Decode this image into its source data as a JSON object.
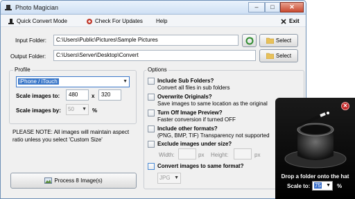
{
  "window": {
    "title": "Photo Magician",
    "controls": {
      "minimize": "–",
      "maximize": "□",
      "close": "✕"
    }
  },
  "menu": {
    "quick_convert": "Quick Convert Mode",
    "check_updates": "Check For Updates",
    "help": "Help",
    "exit": "Exit"
  },
  "folders": {
    "input_label": "Input Folder:",
    "input_value": "C:\\Users\\Public\\Pictures\\Sample Pictures",
    "output_label": "Output Folder:",
    "output_value": "C:\\Users\\Server\\Desktop\\Convert",
    "select_label": "Select"
  },
  "profile": {
    "group_title": "Profile",
    "selected": "iPhone / iTouch",
    "scale_to_label": "Scale images to:",
    "width": "480",
    "x_label": "x",
    "height": "320",
    "scale_by_label": "Scale images by:",
    "scale_by_value": "50",
    "percent": "%",
    "note": "PLEASE NOTE: All images will maintain aspect ratio unless you select 'Custom Size'",
    "process_button": "Process 8 Image(s)"
  },
  "options": {
    "group_title": "Options",
    "items": [
      {
        "title": "Include Sub Folders?",
        "sub": "Convert all files in sub folders"
      },
      {
        "title": "Overwrite Originals?",
        "sub": "Save images to same location as the original"
      },
      {
        "title": "Turn Off Image Preview?",
        "sub": "Faster conversion if turned OFF"
      },
      {
        "title": "Include other formats?",
        "sub": "(PNG, BMP, TIF) Transparency not supported"
      },
      {
        "title": "Exclude images under size?",
        "sub": ""
      },
      {
        "title": "Convert images to same format?",
        "sub": ""
      }
    ],
    "exclude_width_label": "Width:",
    "exclude_height_label": "Height:",
    "px": "px",
    "format_value": "JPG"
  },
  "popup": {
    "message": "Drop a folder onto the hat",
    "scale_label": "Scale to:",
    "scale_value": "75",
    "percent": "%"
  }
}
